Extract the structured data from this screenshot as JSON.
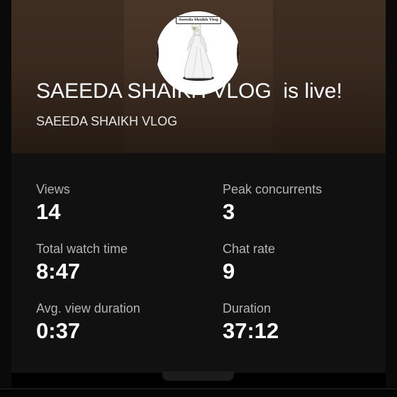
{
  "banner": {
    "avatar_caption": "Saeeda Shaikh Vlog",
    "live_title": "SAEEDA SHAIKH VLOG  is live!",
    "channel_name": "SAEEDA SHAIKH VLOG"
  },
  "stats": [
    {
      "label": "Views",
      "value": "14"
    },
    {
      "label": "Peak concurrents",
      "value": "3"
    },
    {
      "label": "Total watch time",
      "value": "8:47"
    },
    {
      "label": "Chat rate",
      "value": "9"
    },
    {
      "label": "Avg. view duration",
      "value": "0:37"
    },
    {
      "label": "Duration",
      "value": "37:12"
    }
  ],
  "colors": {
    "banner": "#3b2b20",
    "stats_background": "#111111",
    "label": "#b3b3b3",
    "value": "#ffffff"
  }
}
